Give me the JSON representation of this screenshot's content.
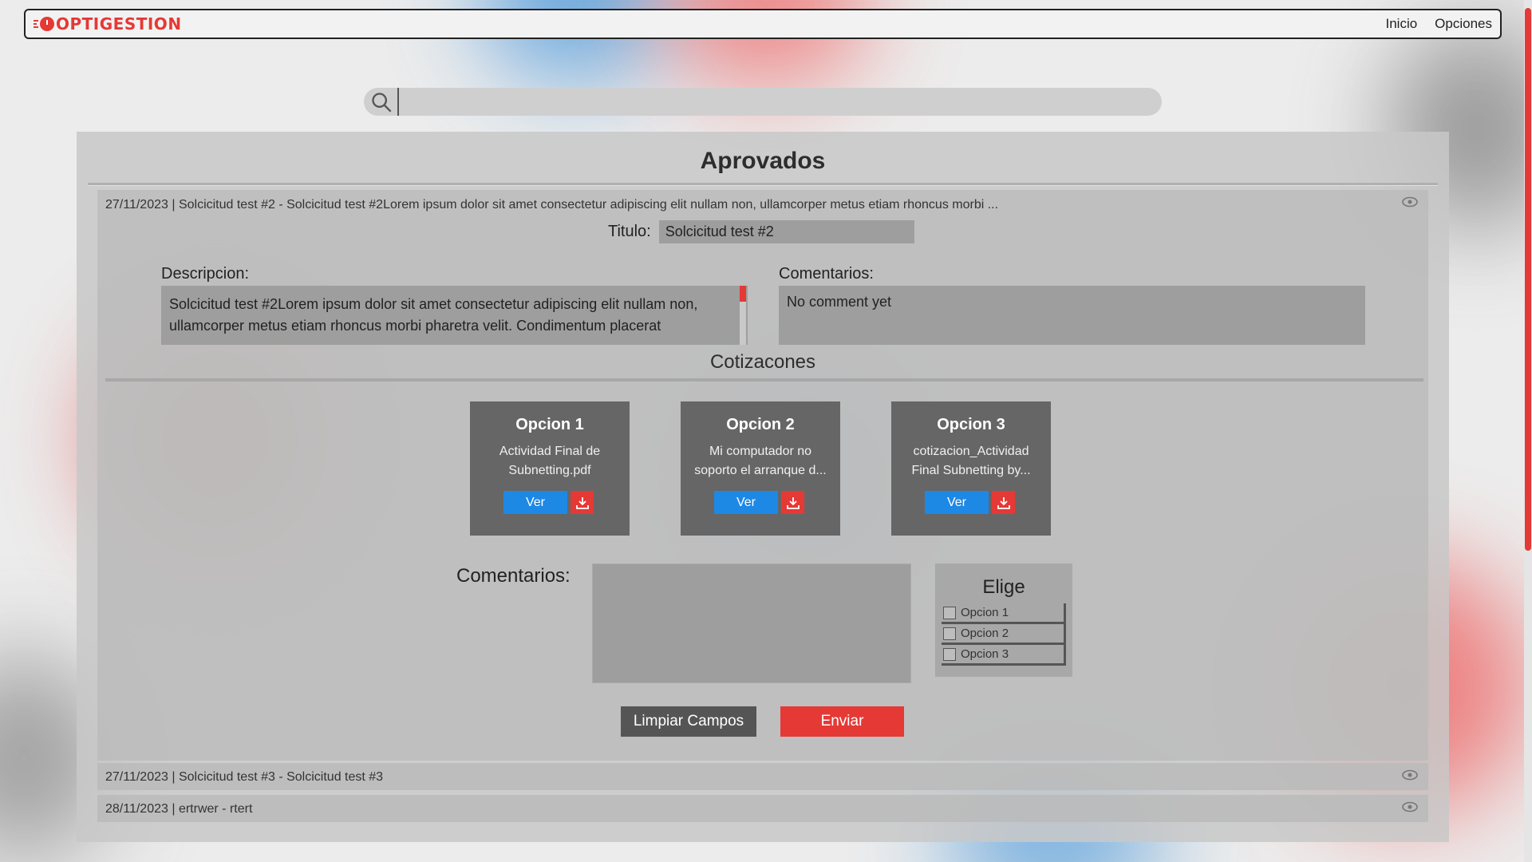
{
  "navbar": {
    "logo": "OPTIGESTION",
    "links": [
      "Inicio",
      "Opciones"
    ]
  },
  "search": {
    "value": "",
    "placeholder": ""
  },
  "panel": {
    "title": "Aprovados",
    "open_request": {
      "header": "27/11/2023 | Solcicitud test #2 - Solcicitud test #2Lorem ipsum dolor sit amet consectetur adipiscing elit nullam non, ullamcorper metus etiam rhoncus morbi ...",
      "titulo_label": "Titulo:",
      "titulo_value": "Solcicitud test #2",
      "descripcion_label": "Descripcion:",
      "descripcion_value": "Solcicitud test #2Lorem ipsum dolor sit amet consectetur adipiscing elit nullam non, ullamcorper metus etiam rhoncus morbi pharetra velit. Condimentum placerat",
      "comentarios_label": "Comentarios:",
      "comentarios_value": "No comment  yet",
      "cotizaciones_title": "Cotizacones",
      "cards": [
        {
          "title": "Opcion 1",
          "file": "Actividad Final de Subnetting.pdf",
          "ver": "Ver"
        },
        {
          "title": "Opcion 2",
          "file": "Mi computador no soporto el arranque d...",
          "ver": "Ver"
        },
        {
          "title": "Opcion 3",
          "file": "cotizacion_Actividad Final Subnetting by...",
          "ver": "Ver"
        }
      ],
      "comentarios2_label": "Comentarios:",
      "elige": {
        "title": "Elige",
        "options": [
          "Opcion 1",
          "Opcion 2",
          "Opcion 3"
        ]
      },
      "btn_clear": "Limpiar Campos",
      "btn_send": "Enviar"
    },
    "other_requests": [
      "27/11/2023 | Solcicitud test #3 - Solcicitud test #3",
      "28/11/2023 | ertrwer - rtert"
    ]
  },
  "colors": {
    "accent": "#e53935",
    "primary": "#1e88e5",
    "card": "#666666"
  },
  "icons": [
    "search-icon",
    "eye-icon",
    "download-icon",
    "checkbox-icon"
  ]
}
